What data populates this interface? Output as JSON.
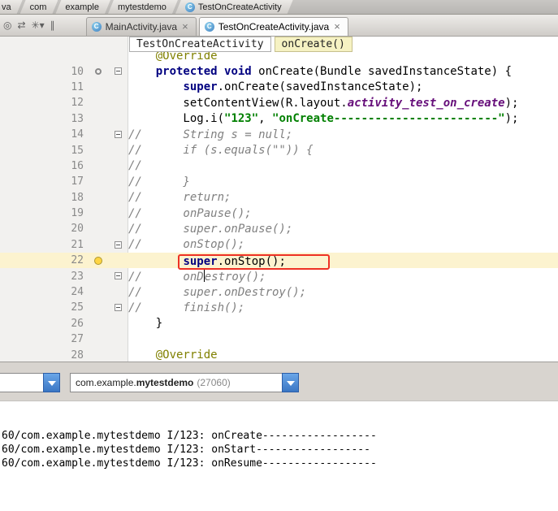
{
  "nav_bar": {
    "items": [
      {
        "label": "va",
        "icon": null
      },
      {
        "label": "com",
        "icon": null
      },
      {
        "label": "example",
        "icon": null
      },
      {
        "label": "mytestdemo",
        "icon": null
      },
      {
        "label": "TestOnCreateActivity",
        "icon": "class"
      }
    ]
  },
  "toolbar_icons": [
    {
      "name": "scroll-from-source-icon",
      "glyph": "◎"
    },
    {
      "name": "sync-icon",
      "glyph": "⇄"
    },
    {
      "name": "settings-icon",
      "glyph": "✳▾"
    },
    {
      "name": "pin-icon",
      "glyph": "∥"
    }
  ],
  "tabs": [
    {
      "label": "MainActivity.java",
      "close": "×",
      "active": false,
      "icon": "class"
    },
    {
      "label": "TestOnCreateActivity.java",
      "close": "×",
      "active": true,
      "icon": "class"
    }
  ],
  "breadcrumbs": {
    "class_label": "TestOnCreateActivity",
    "method_label": "onCreate()"
  },
  "editor": {
    "lines": [
      {
        "num": "",
        "icon": null,
        "fold": false,
        "active": false,
        "tokens": [
          {
            "t": "    ",
            "c": "p"
          },
          {
            "t": "@Override",
            "c": "a"
          }
        ]
      },
      {
        "num": "10",
        "icon": "override",
        "fold": true,
        "active": false,
        "tokens": [
          {
            "t": "    ",
            "c": "p"
          },
          {
            "t": "protected",
            "c": "k"
          },
          {
            "t": " ",
            "c": "p"
          },
          {
            "t": "void",
            "c": "k"
          },
          {
            "t": " onCreate(Bundle savedInstanceState) {",
            "c": "p"
          }
        ]
      },
      {
        "num": "11",
        "icon": null,
        "fold": false,
        "active": false,
        "tokens": [
          {
            "t": "        ",
            "c": "p"
          },
          {
            "t": "super",
            "c": "k"
          },
          {
            "t": ".onCreate(savedInstanceState);",
            "c": "p"
          }
        ]
      },
      {
        "num": "12",
        "icon": null,
        "fold": false,
        "active": false,
        "tokens": [
          {
            "t": "        setContentView(R.layout.",
            "c": "p"
          },
          {
            "t": "activity_test_on_create",
            "c": "f"
          },
          {
            "t": ");",
            "c": "p"
          }
        ]
      },
      {
        "num": "13",
        "icon": null,
        "fold": false,
        "active": false,
        "tokens": [
          {
            "t": "        Log.i(",
            "c": "p"
          },
          {
            "t": "\"123\"",
            "c": "s"
          },
          {
            "t": ", ",
            "c": "p"
          },
          {
            "t": "\"onCreate------------------------\"",
            "c": "s"
          },
          {
            "t": ");",
            "c": "p"
          }
        ]
      },
      {
        "num": "14",
        "icon": null,
        "fold": true,
        "active": false,
        "tokens": [
          {
            "t": "//      String s = null;",
            "c": "c"
          }
        ]
      },
      {
        "num": "15",
        "icon": null,
        "fold": false,
        "active": false,
        "tokens": [
          {
            "t": "//      if (s.equals(\"\")) {",
            "c": "c"
          }
        ]
      },
      {
        "num": "16",
        "icon": null,
        "fold": false,
        "active": false,
        "tokens": [
          {
            "t": "//",
            "c": "c"
          }
        ]
      },
      {
        "num": "17",
        "icon": null,
        "fold": false,
        "active": false,
        "tokens": [
          {
            "t": "//      }",
            "c": "c"
          }
        ]
      },
      {
        "num": "18",
        "icon": null,
        "fold": false,
        "active": false,
        "tokens": [
          {
            "t": "//      return;",
            "c": "c"
          }
        ]
      },
      {
        "num": "19",
        "icon": null,
        "fold": false,
        "active": false,
        "tokens": [
          {
            "t": "//      onPause();",
            "c": "c"
          }
        ]
      },
      {
        "num": "20",
        "icon": null,
        "fold": false,
        "active": false,
        "tokens": [
          {
            "t": "//      super.onPause();",
            "c": "c"
          }
        ]
      },
      {
        "num": "21",
        "icon": null,
        "fold": true,
        "active": false,
        "tokens": [
          {
            "t": "//      onStop();",
            "c": "c"
          }
        ]
      },
      {
        "num": "22",
        "icon": "bulb",
        "fold": false,
        "active": true,
        "tokens": [
          {
            "t": "        ",
            "c": "p"
          },
          {
            "box": [
              {
                "t": "super",
                "c": "k"
              },
              {
                "t": ".onStop();",
                "c": "p"
              }
            ]
          }
        ]
      },
      {
        "num": "23",
        "icon": null,
        "fold": true,
        "active": false,
        "tokens": [
          {
            "t": "//      onD",
            "c": "c"
          },
          {
            "caret": true
          },
          {
            "t": "estroy();",
            "c": "c"
          }
        ]
      },
      {
        "num": "24",
        "icon": null,
        "fold": false,
        "active": false,
        "tokens": [
          {
            "t": "//      super.onDestroy();",
            "c": "c"
          }
        ]
      },
      {
        "num": "25",
        "icon": null,
        "fold": true,
        "active": false,
        "tokens": [
          {
            "t": "//      finish();",
            "c": "c"
          }
        ]
      },
      {
        "num": "26",
        "icon": null,
        "fold": false,
        "active": false,
        "tokens": [
          {
            "t": "    }",
            "c": "p"
          }
        ]
      },
      {
        "num": "27",
        "icon": null,
        "fold": false,
        "active": false,
        "tokens": []
      },
      {
        "num": "28",
        "icon": null,
        "fold": false,
        "active": false,
        "tokens": [
          {
            "t": "    ",
            "c": "p"
          },
          {
            "t": "@Override",
            "c": "a"
          }
        ]
      }
    ]
  },
  "console": {
    "process_prefix": "com.example.",
    "process_bold": "mytestdemo",
    "process_pid": "(27060)",
    "logs": [
      "60/com.example.mytestdemo I/123: onCreate------------------",
      "60/com.example.mytestdemo I/123: onStart------------------",
      "60/com.example.mytestdemo I/123: onResume------------------"
    ]
  },
  "colors": {
    "keyword": "#000080",
    "string": "#008000",
    "comment": "#808080",
    "annotation": "#808000",
    "static_field": "#660E7A",
    "accent_blue": "#3a76c4",
    "red_box": "#ee3124",
    "active_line": "#fcf3cf"
  }
}
